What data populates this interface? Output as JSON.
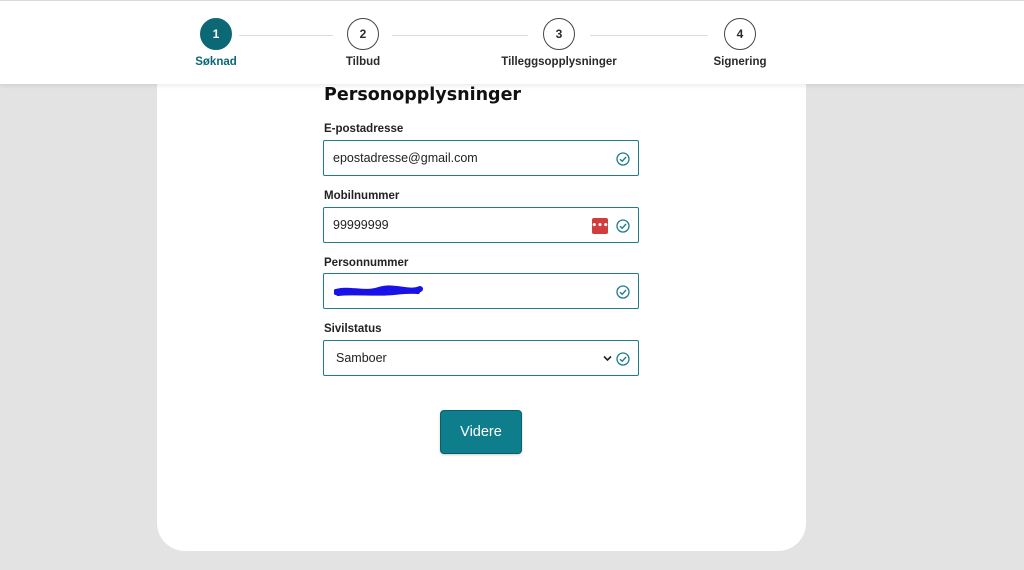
{
  "stepper": {
    "steps": [
      {
        "number": "1",
        "label": "Søknad",
        "active": true
      },
      {
        "number": "2",
        "label": "Tilbud",
        "active": false
      },
      {
        "number": "3",
        "label": "Tilleggsopplysninger",
        "active": false
      },
      {
        "number": "4",
        "label": "Signering",
        "active": false
      }
    ]
  },
  "form": {
    "title": "Personopplysninger",
    "email": {
      "label": "E-postadresse",
      "value": "epostadresse@gmail.com",
      "valid": true
    },
    "mobile": {
      "label": "Mobilnummer",
      "value": "99999999",
      "valid": true,
      "password_manager_icon": "password-manager-icon"
    },
    "ssn": {
      "label": "Personnummer",
      "value": "",
      "redacted": true,
      "valid": true
    },
    "marital": {
      "label": "Sivilstatus",
      "selected": "Samboer",
      "valid": true
    },
    "submit_label": "Videre"
  },
  "colors": {
    "accent": "#0c6874",
    "button": "#0f7e8c",
    "field_border": "#1f7d88",
    "page_background": "#e3e3e3",
    "redaction": "#1a10e8",
    "password_icon": "#d13c3c"
  }
}
